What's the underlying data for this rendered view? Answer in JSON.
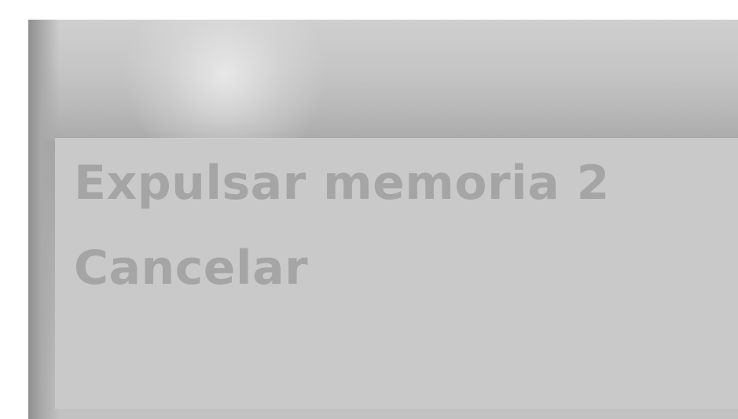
{
  "menu": {
    "items": [
      {
        "label": "Expulsar memoria 2"
      },
      {
        "label": "Cancelar"
      }
    ]
  },
  "colors": {
    "panel": "#c9c9c9",
    "header": "#bcbcbc",
    "text": "#a5a5a5"
  }
}
